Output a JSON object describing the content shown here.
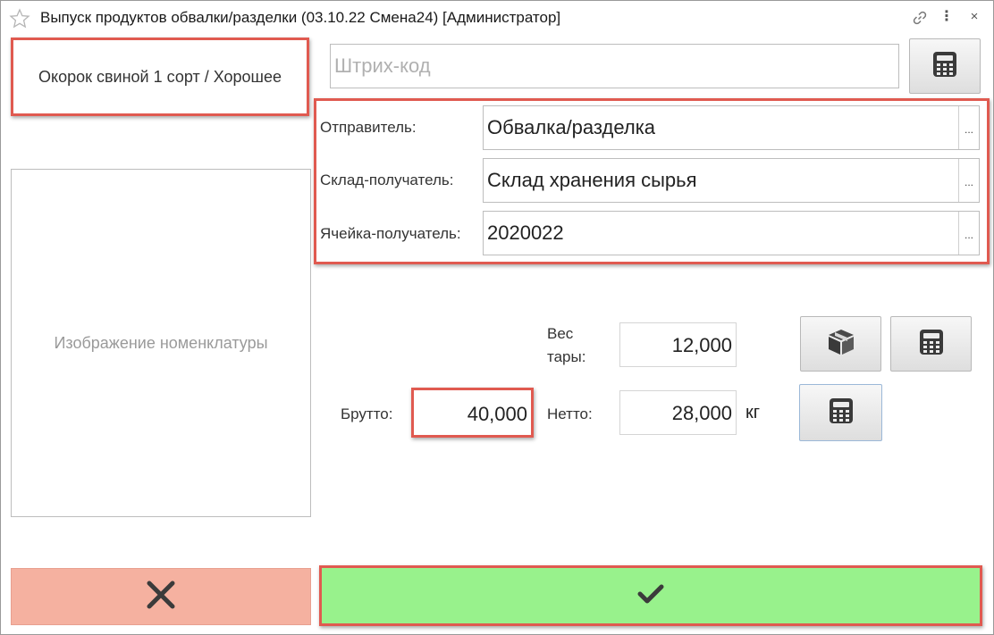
{
  "window": {
    "title": "Выпуск продуктов обвалки/разделки (03.10.22 Смена24) [Администратор]",
    "more_glyph": "⋮",
    "close_glyph": "×"
  },
  "product": {
    "name": "Окорок свиной 1 сорт / Хорошее"
  },
  "barcode": {
    "placeholder": "Штрих-код",
    "value": ""
  },
  "fields": {
    "sender": {
      "label": "Отправитель:",
      "value": "Обвалка/разделка"
    },
    "warehouse": {
      "label": "Склад-получатель:",
      "value": "Склад хранения сырья"
    },
    "cell": {
      "label": "Ячейка-получатель:",
      "value": "2020022"
    },
    "select_glyph": "..."
  },
  "image_placeholder": "Изображение номенклатуры",
  "weights": {
    "tare_label_line1": "Вес",
    "tare_label_line2": "тары:",
    "tare_value": "12,000",
    "gross_label": "Брутто:",
    "gross_value": "40,000",
    "net_label": "Нетто:",
    "net_value": "28,000",
    "unit": "кг"
  },
  "icons": {
    "favorite": "star-icon",
    "link": "link-icon",
    "calculator": "calculator-icon",
    "box": "box-icon",
    "cancel": "close-icon",
    "confirm": "check-icon"
  },
  "colors": {
    "highlight": "#e05a50",
    "cancel_bg": "#f5b1a0",
    "confirm_bg": "#98f28c"
  }
}
